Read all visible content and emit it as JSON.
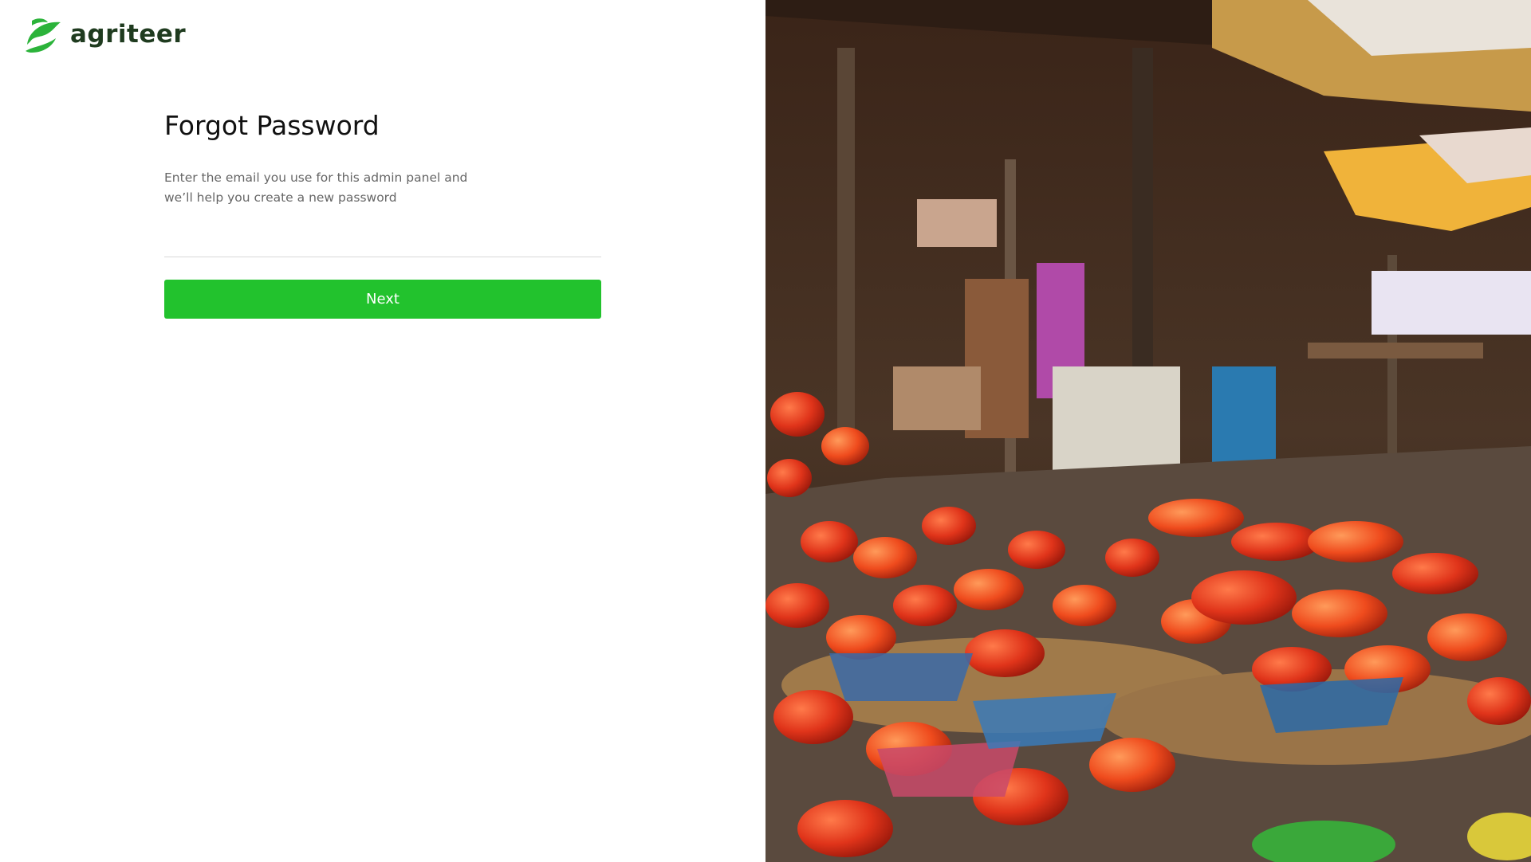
{
  "brand": {
    "name": "agriteer",
    "logo_icon": "leaf-logo-icon",
    "logo_color": "#2bb33a",
    "text_color": "#1f3b1f"
  },
  "form": {
    "title": "Forgot Password",
    "subtitle": "Enter the email you use for this admin panel and we’ll help you create a new password",
    "email_value": "",
    "next_label": "Next",
    "button_color": "#22c22d"
  },
  "hero_image": {
    "subject": "market-stall-peppers-photo"
  }
}
